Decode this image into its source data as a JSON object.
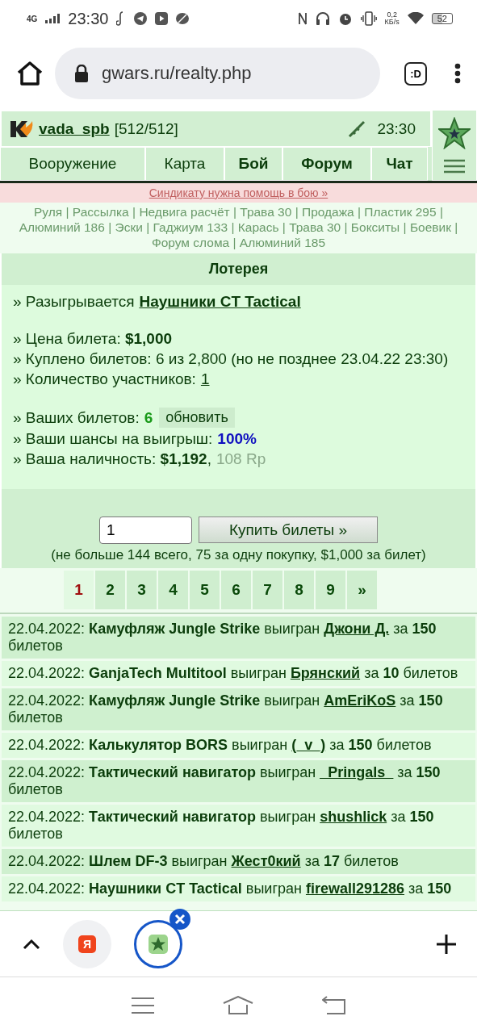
{
  "status_bar": {
    "network": "4G",
    "time": "23:30",
    "speed_value": "0,2",
    "speed_unit": "КБ/s",
    "battery": "52"
  },
  "browser": {
    "url": "gwars.ru/realty.php",
    "tab_switcher": ":D"
  },
  "header": {
    "username": "vada_spb",
    "hp": "[512/512]",
    "time": "23:30"
  },
  "nav": [
    {
      "label": "Вооружение",
      "highlighted": false
    },
    {
      "label": "Карта",
      "highlighted": false
    },
    {
      "label": "Бой",
      "highlighted": true
    },
    {
      "label": "Форум",
      "highlighted": true
    },
    {
      "label": "Чат",
      "highlighted": true
    }
  ],
  "alert": "Синдикату нужна помощь в бою »",
  "quick_links": {
    "separator": "|",
    "items": [
      "Руля",
      "Рассылка",
      "Недвига расчёт",
      "Трава 30",
      "Продажа",
      "Пластик 295",
      "Алюминий 186",
      "Эски",
      "Гаджиум 133",
      "Карась",
      "Трава 30",
      "Бокситы",
      "Боевик",
      "Форум слома",
      "Алюминий 185"
    ]
  },
  "lottery": {
    "title": "Лотерея",
    "groups": [
      [
        {
          "kind": "link",
          "text": "» Разыгрывается",
          "value": "Наушники CT Tactical"
        }
      ],
      [
        {
          "kind": "text",
          "text": "» Цена билета: **$1,000**"
        },
        {
          "kind": "text",
          "text": "» Куплено билетов: 6 из 2,800 (но не позднее 23.04.22 23:30)"
        },
        {
          "kind": "plainlink",
          "text": "» Количество участников:",
          "value": "1"
        }
      ],
      [
        {
          "kind": "tickets",
          "text": "» Ваших билетов:",
          "value": "6",
          "button": "обновить"
        },
        {
          "kind": "chance",
          "text": "» Ваши шансы на выигрыш:",
          "value": "100%"
        },
        {
          "kind": "cash",
          "text": "» Ваша наличность: **$1,192**,",
          "value": "108 Rp"
        }
      ]
    ],
    "quantity": "1",
    "buy_button": "Купить билеты »",
    "limits": "(не больше 144 всего, 75 за одну покупку, $1,000 за билет)"
  },
  "pages": [
    {
      "label": "1",
      "selected": true
    },
    {
      "label": "2",
      "selected": false
    },
    {
      "label": "3",
      "selected": false
    },
    {
      "label": "4",
      "selected": false
    },
    {
      "label": "5",
      "selected": false
    },
    {
      "label": "6",
      "selected": false
    },
    {
      "label": "7",
      "selected": false
    },
    {
      "label": "8",
      "selected": false
    },
    {
      "label": "9",
      "selected": false
    },
    {
      "label": "»",
      "selected": false
    }
  ],
  "history": [
    {
      "before": "22.04.2022: **Камуфляж Jungle Strike** выигран",
      "winner": "Джони Д.",
      "after": "за **150** билетов"
    },
    {
      "before": "22.04.2022: **GanjaTech Multitool** выигран",
      "winner": "Брянский",
      "after": "за **10** билетов"
    },
    {
      "before": "22.04.2022: **Камуфляж Jungle Strike** выигран",
      "winner": "AmEriKoS",
      "after": "за **150** билетов"
    },
    {
      "before": "22.04.2022: **Калькулятор BORS** выигран",
      "winner": "(_v_)",
      "after": "за **150** билетов"
    },
    {
      "before": "22.04.2022: **Тактический навигатор** выигран",
      "winner": "_Pringals_",
      "after": "за **150** билетов"
    },
    {
      "before": "22.04.2022: **Тактический навигатор** выигран",
      "winner": "shushlick",
      "after": "за **150** билетов"
    },
    {
      "before": "22.04.2022: **Шлем DF-3** выигран",
      "winner": "Жест0кий",
      "after": "за **17** билетов"
    },
    {
      "before": "22.04.2022: **Наушники CT Tactical** выигран",
      "winner": "firewall291286",
      "after": "за **150**"
    }
  ],
  "tabs": [
    {
      "logo": "Я",
      "selected": false
    },
    {
      "selected": true
    }
  ]
}
